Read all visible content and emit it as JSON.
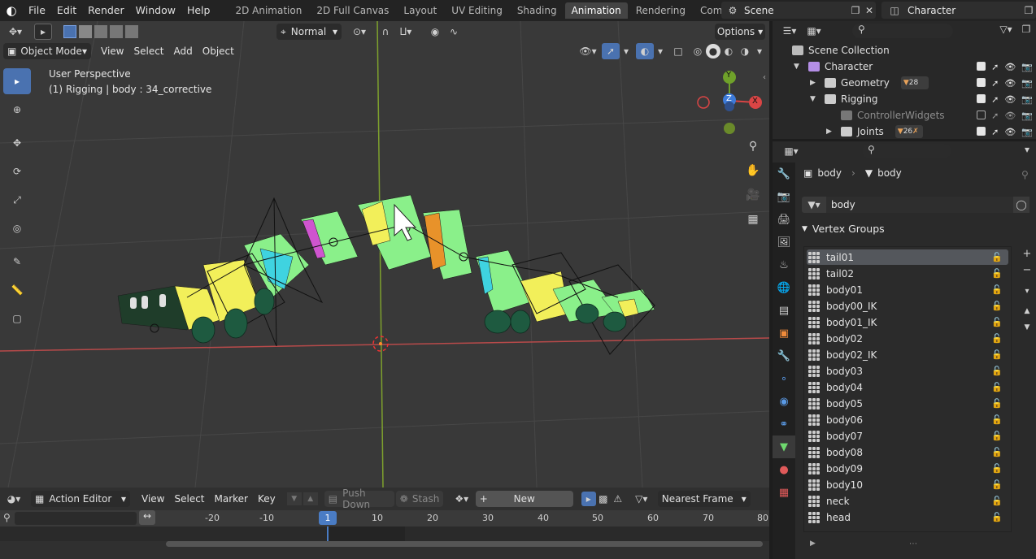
{
  "topbar": {
    "menus": [
      "File",
      "Edit",
      "Render",
      "Window",
      "Help"
    ],
    "workspaces": [
      "2D Animation",
      "2D Full Canvas",
      "Layout",
      "UV Editing",
      "Shading",
      "Animation",
      "Rendering",
      "Compositing"
    ],
    "active_workspace": "Animation",
    "scene": "Scene",
    "view_layer": "Character"
  },
  "viewport": {
    "orientation": "Normal",
    "options_label": "Options",
    "mode": "Object Mode",
    "menus": [
      "View",
      "Select",
      "Add",
      "Object"
    ],
    "perspective_label": "User Perspective",
    "context_label": "(1) Rigging | body : 34_corrective",
    "gizmo": {
      "y": "Y",
      "z": "Z",
      "x": "X"
    }
  },
  "action_editor": {
    "editor_type": "Action Editor",
    "menus": [
      "View",
      "Select",
      "Marker",
      "Key"
    ],
    "push_down": "Push Down",
    "stash": "Stash",
    "new_label": "New",
    "snap": "Nearest Frame",
    "ruler_ticks": [
      "-20",
      "-10",
      "1",
      "10",
      "20",
      "30",
      "40",
      "50",
      "60",
      "70",
      "80"
    ],
    "current_frame": "1"
  },
  "outliner": {
    "items": [
      {
        "label": "Scene Collection",
        "level": 0
      },
      {
        "label": "Character",
        "level": 1
      },
      {
        "label": "Geometry",
        "level": 2,
        "badge": "28"
      },
      {
        "label": "Rigging",
        "level": 2
      },
      {
        "label": "ControllerWidgets",
        "level": 3
      },
      {
        "label": "Joints",
        "level": 3,
        "badge": "26"
      }
    ]
  },
  "properties": {
    "object_name": "body",
    "data_name": "body",
    "mesh_field": "body",
    "panel_title": "Vertex Groups",
    "vertex_groups": [
      "tail01",
      "tail02",
      "body01",
      "body00_IK",
      "body01_IK",
      "body02",
      "body02_IK",
      "body03",
      "body04",
      "body05",
      "body06",
      "body07",
      "body08",
      "body09",
      "body10",
      "neck",
      "head"
    ],
    "selected_group": "tail01"
  },
  "colors": {
    "accent": "#4a72b0",
    "mesh_green": "#8af08a",
    "mesh_yellow": "#f2ef5a",
    "axis_red": "#d94545",
    "axis_green": "#6fa12a",
    "axis_blue": "#3d7bd9"
  }
}
